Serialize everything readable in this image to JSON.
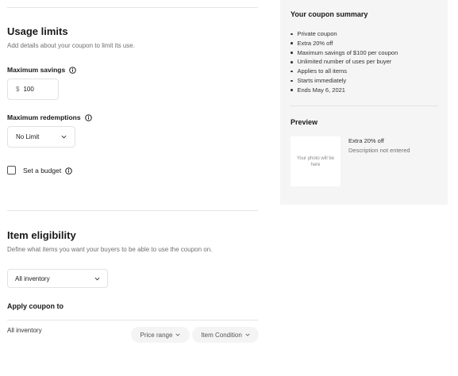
{
  "usage_limits": {
    "title": "Usage limits",
    "subtitle": "Add details about your coupon to limit its use.",
    "max_savings": {
      "label": "Maximum savings",
      "currency": "$",
      "value": "100"
    },
    "max_redemptions": {
      "label": "Maximum redemptions",
      "value": "No Limit"
    },
    "budget": {
      "label": "Set a budget",
      "checked": false
    }
  },
  "item_eligibility": {
    "title": "Item eligibility",
    "subtitle": "Define what items you want your buyers to be able to use the coupon on.",
    "scope_select": "All inventory",
    "apply_title": "Apply coupon to",
    "apply_row": {
      "label": "All inventory",
      "price_range": "Price range",
      "item_condition": "Item Condition"
    }
  },
  "summary": {
    "title": "Your coupon summary",
    "items": [
      "Private coupon",
      "Extra 20% off",
      "Maximum savings of $100 per coupon",
      "Unlimited number of uses per buyer",
      "Applies to all items",
      "Starts immediately",
      "Ends May 6, 2021"
    ],
    "preview_title": "Preview",
    "photo_placeholder": "Your photo will be here",
    "preview_offer": "Extra 20% off",
    "preview_description": "Description not entered"
  },
  "icons": {
    "info": "info-icon",
    "chevron": "chevron-down-icon",
    "checkbox": "checkbox"
  },
  "colors": {
    "text": "#191919",
    "muted": "#707070",
    "panel": "#f5f5f5",
    "border": "#e2e2e2"
  }
}
